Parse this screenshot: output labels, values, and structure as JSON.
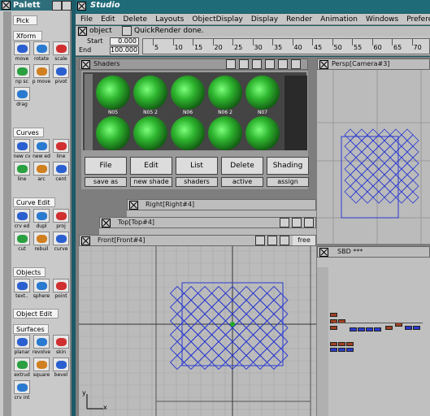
{
  "palette": {
    "title": "Palett",
    "sections": [
      "Pick",
      "Xform",
      "Curves",
      "Curve Edit",
      "Objects",
      "Object Edit",
      "Surfaces"
    ],
    "xform_tools": [
      "move",
      "rotate",
      "scale",
      "np sc",
      "p move",
      "pivot",
      "drag"
    ],
    "curve_tools": [
      "new cv",
      "new ed",
      "line",
      "line",
      "arc",
      "cent"
    ],
    "curveedit_tools": [
      "crv ed",
      "dupl",
      "proj",
      "cut",
      "rebuil",
      "curve"
    ],
    "object_tools": [
      "text..",
      "sphere",
      "point"
    ],
    "surface_tools": [
      "planar",
      "revolve",
      "skin",
      "extrud",
      "square",
      "bevel",
      "crv int"
    ]
  },
  "app": {
    "title": "Studio",
    "menu": [
      "File",
      "Edit",
      "Delete",
      "Layouts",
      "ObjectDisplay",
      "Display",
      "Render",
      "Animation",
      "Windows",
      "Preferen"
    ],
    "object_label": "object",
    "status": "QuickRender done."
  },
  "timeline": {
    "start_label": "Start",
    "end_label": "End",
    "start_value": "0.000",
    "end_value": "100.000",
    "ticks": [
      "5",
      "10",
      "15",
      "20",
      "25",
      "30",
      "35",
      "40",
      "45",
      "50",
      "55",
      "60",
      "65",
      "70"
    ]
  },
  "shaders": {
    "title": "Shaders",
    "row1": [
      "N05",
      "N05 2",
      "N06",
      "N06 2",
      "N07"
    ],
    "buttons": [
      "File",
      "Edit",
      "List",
      "Delete",
      "Shading"
    ],
    "subbuttons": [
      "save as",
      "new shade",
      "shaders",
      "active",
      "assign"
    ]
  },
  "windows": {
    "persp": "Persp[Camera#3]",
    "right": "Right[Right#4]",
    "top": "Top[Top#4]",
    "front": "Front[Front#4]",
    "front_mode": "free",
    "sbd": "SBD ***"
  },
  "axes": {
    "x": "x",
    "y": "y"
  }
}
